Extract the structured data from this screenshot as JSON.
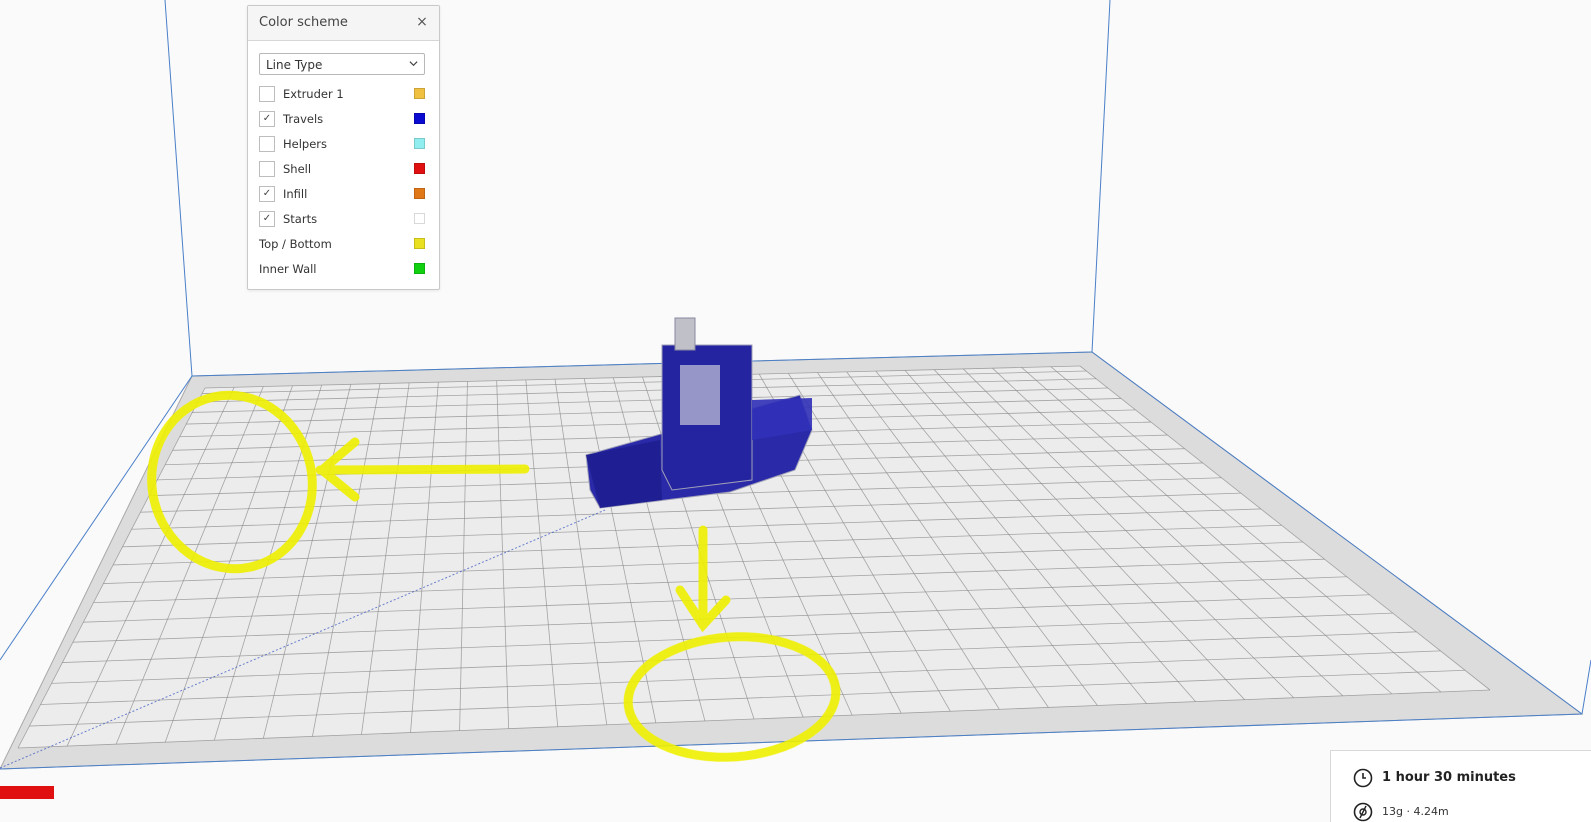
{
  "color_scheme": {
    "title": "Color scheme",
    "close_symbol": "×",
    "dropdown_value": "Line Type",
    "items": [
      {
        "label": "Extruder 1",
        "checked": false,
        "has_checkbox": true,
        "color": "#f0c040"
      },
      {
        "label": "Travels",
        "checked": true,
        "has_checkbox": true,
        "color": "#0a0ad0"
      },
      {
        "label": "Helpers",
        "checked": false,
        "has_checkbox": true,
        "color": "#90eef0"
      },
      {
        "label": "Shell",
        "checked": false,
        "has_checkbox": true,
        "color": "#e01010"
      },
      {
        "label": "Infill",
        "checked": true,
        "has_checkbox": true,
        "color": "#e07818"
      },
      {
        "label": "Starts",
        "checked": true,
        "has_checkbox": true,
        "color": "#ffffff"
      },
      {
        "label": "Top / Bottom",
        "checked": false,
        "has_checkbox": false,
        "color": "#e8e020"
      },
      {
        "label": "Inner Wall",
        "checked": false,
        "has_checkbox": false,
        "color": "#10d010"
      }
    ],
    "check_symbol": "✓"
  },
  "print_info": {
    "time": "1 hour 30 minutes",
    "material": "13g · 4.24m"
  },
  "colors": {
    "build_plate": "#dcdcdc",
    "grid_lines": "#8c8c8c",
    "volume_edges": "#4a7fc8",
    "model_travel": "#1a1ab0",
    "annotation": "#f0f000",
    "axis_x": "#e01010"
  }
}
